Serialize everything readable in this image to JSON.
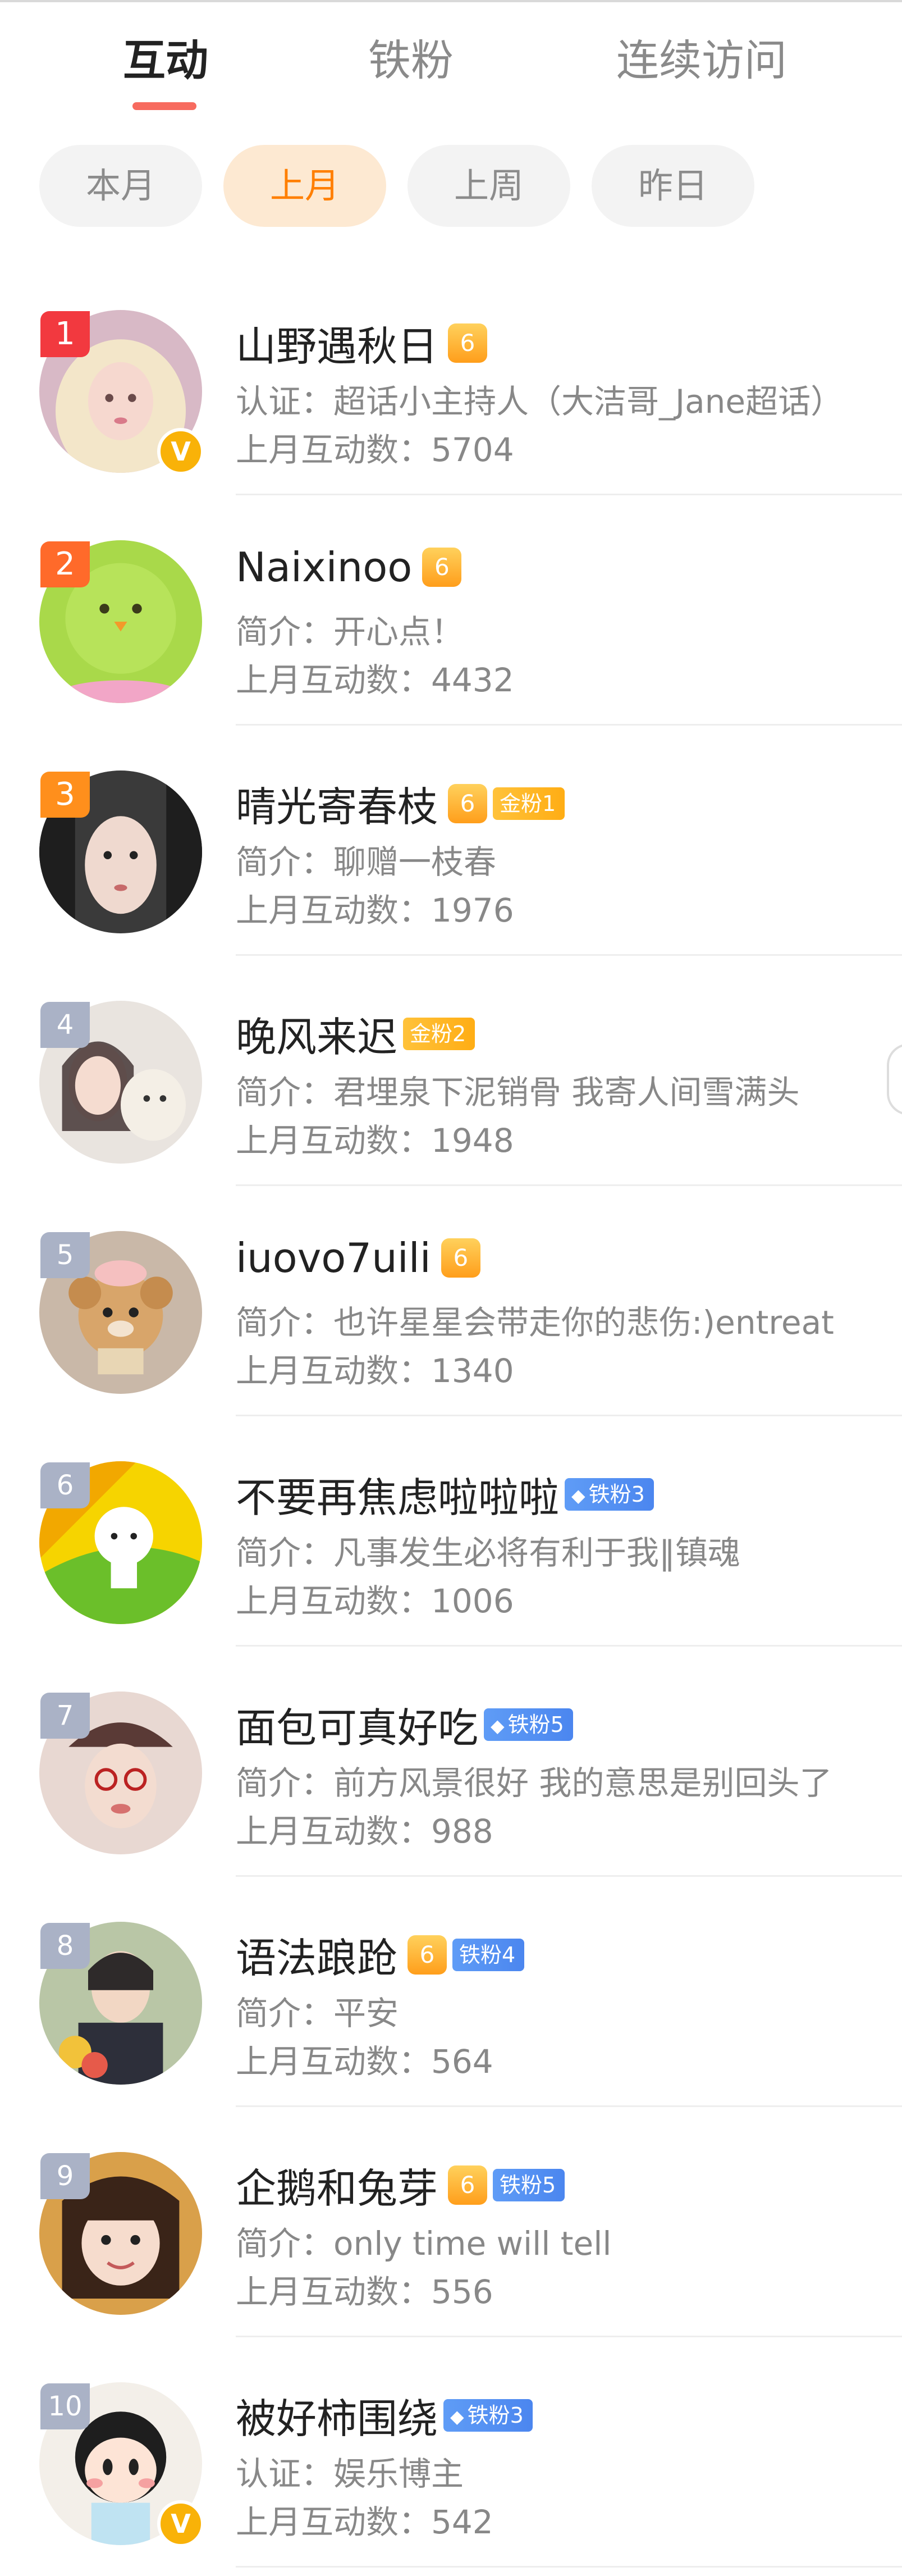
{
  "tabs": [
    {
      "label": "互动",
      "active": true
    },
    {
      "label": "铁粉",
      "active": false
    },
    {
      "label": "连续访问",
      "active": false
    }
  ],
  "periods": [
    {
      "label": "本月",
      "active": false
    },
    {
      "label": "上月",
      "active": true
    },
    {
      "label": "上周",
      "active": false
    },
    {
      "label": "昨日",
      "active": false
    }
  ],
  "colors": {
    "accent": "#f76b5f",
    "chip_active_text": "#ff7f00",
    "iron_badge": "#4b86ef",
    "gold_badge": "#ffad14"
  },
  "users": [
    {
      "rank": "1",
      "name": "山野遇秋日",
      "crown": "6",
      "badge": "",
      "desc": "认证：超话小主持人（大洁哥_Jane超话）",
      "count": "上月互动数：5704",
      "verified": true,
      "avatar_icon": "blonde-girl-avatar"
    },
    {
      "rank": "2",
      "name": "Naixinoo",
      "crown": "6",
      "badge": "",
      "desc": "简介：开心点！",
      "count": "上月互动数：4432",
      "verified": false,
      "avatar_icon": "green-chick-avatar"
    },
    {
      "rank": "3",
      "name": "晴光寄春枝",
      "crown": "6",
      "badge": "金粉1",
      "badge_type": "gold",
      "desc": "简介：聊赠一枝春",
      "count": "上月互动数：1976",
      "verified": false,
      "avatar_icon": "dark-hair-girl-avatar"
    },
    {
      "rank": "4",
      "name": "晚风来迟",
      "crown": "",
      "badge": "金粉2",
      "badge_type": "gold",
      "desc": "简介：君埋泉下泥销骨 我寄人间雪满头",
      "count": "上月互动数：1948",
      "verified": false,
      "avatar_icon": "girl-with-alpaca-avatar"
    },
    {
      "rank": "5",
      "name": "iuovo7uili",
      "crown": "6",
      "badge": "",
      "desc": "简介：也许星星会带走你的悲伤:)entreat",
      "count": "上月互动数：1340",
      "verified": false,
      "avatar_icon": "plush-dog-avatar"
    },
    {
      "rank": "6",
      "name": "不要再焦虑啦啦啦",
      "crown": "",
      "badge": "铁粉3",
      "badge_type": "iron",
      "desc": "简介：凡事发生必将有利于我‖镇魂",
      "count": "上月互动数：1006",
      "verified": false,
      "avatar_icon": "cartoon-sheep-avatar"
    },
    {
      "rank": "7",
      "name": "面包可真好吃",
      "crown": "",
      "badge": "铁粉5",
      "badge_type": "iron",
      "desc": "简介：前方风景很好 我的意思是别回头了",
      "count": "上月互动数：988",
      "verified": false,
      "avatar_icon": "girl-with-hat-avatar"
    },
    {
      "rank": "8",
      "name": "语法踉跄",
      "crown": "6",
      "badge": "铁粉4",
      "badge_type": "iron",
      "desc": "简介：平安",
      "count": "上月互动数：564",
      "verified": false,
      "avatar_icon": "woman-flowers-avatar"
    },
    {
      "rank": "9",
      "name": "企鹅和兔芽",
      "crown": "6",
      "badge": "铁粉5",
      "badge_type": "iron",
      "desc": "简介：only time will tell",
      "count": "上月互动数：556",
      "verified": false,
      "avatar_icon": "smiling-girl-avatar"
    },
    {
      "rank": "10",
      "name": "被好柿围绕",
      "crown": "",
      "badge": "铁粉3",
      "badge_type": "iron",
      "desc": "认证：娱乐博主",
      "count": "上月互动数：542",
      "verified": true,
      "avatar_icon": "cartoon-girl-avatar"
    }
  ]
}
